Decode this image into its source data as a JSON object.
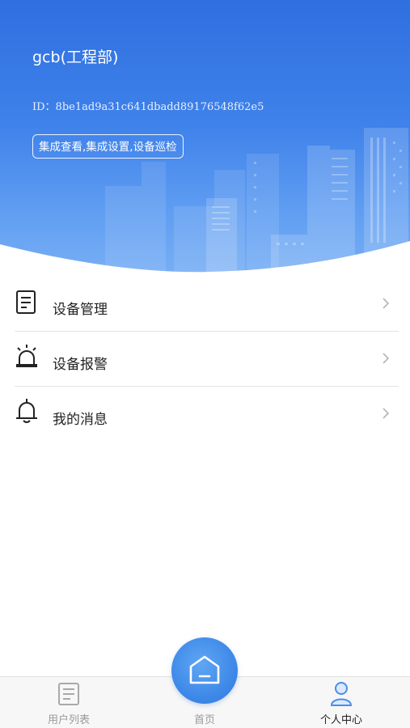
{
  "profile": {
    "username": "gcb(工程部)",
    "user_id": "ID：8be1ad9a31c641dbadd89176548f62e5",
    "permissions": "集成查看,集成设置,设备巡检"
  },
  "menu": {
    "items": [
      {
        "label": "设备管理",
        "icon": "clipboard-icon"
      },
      {
        "label": "设备报警",
        "icon": "alarm-light-icon"
      },
      {
        "label": "我的消息",
        "icon": "bell-icon"
      }
    ]
  },
  "tabbar": {
    "tabs": [
      {
        "label": "用户列表",
        "icon": "document-icon"
      },
      {
        "label": "首页",
        "icon": "home-icon"
      },
      {
        "label": "个人中心",
        "icon": "person-icon"
      }
    ],
    "active": "个人中心"
  },
  "colors": {
    "header_top": "#2f6fe0",
    "header_bottom": "#79b0f5",
    "home_button": "#3f8ae8",
    "active_tab_icon": "#4a8fe6"
  }
}
